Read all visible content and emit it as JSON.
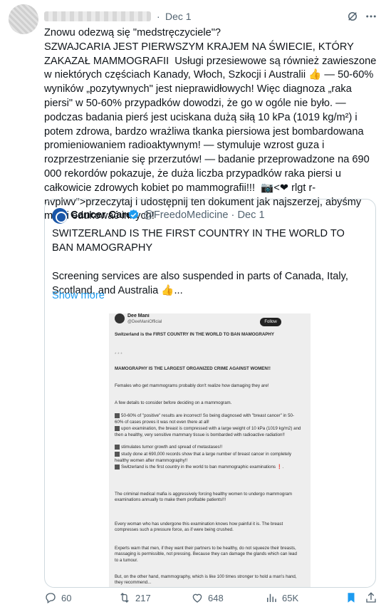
{
  "tweet": {
    "date": "Dec 1",
    "separator": "·",
    "text": "Znowu odezwą się \"medstręczyciele\"?\nSZWAJCARIA JEST PIERWSZYM KRAJEM NA ŚWIECIE, KTÓRY ZAKAZAŁ MAMMOGRAFII  Usługi przesiewowe są również zawieszone w niektórych częściach Kanady, Włoch, Szkocji i Australii 👍 — 50-60% wyników „pozytywnych\" jest nieprawidłowych! Więc diagnoza „raka piersi\" w 50-60% przypadków dowodzi, że go w ogóle nie było. — podczas badania pierś jest uciskana dużą siłą 10 kPa (1019 kg/m²) i potem zdrowa, bardzo wrażliwa tkanka piersiowa jest bombardowana promieniowaniem radioaktywnym! — stymuluje wzrost guza i rozprzestrzenianie się przerzutów! — badanie przeprowadzone na 690 000 rekordów pokazuje, że duża liczba przypadków raka piersi u całkowicie zdrowych kobiet po mammografii!!!  📷<❤ rlgt r-nvplwv\">przeczytaj i udostępnij ten dokument jak najszerzej, abyśmy mogli edukować innych!"
  },
  "quote": {
    "name": "Cancer Care",
    "handle": "@FreedoMedicine",
    "separator": "·",
    "date": "Dec 1",
    "text": "SWITZERLAND IS THE FIRST COUNTRY IN THE WORLD TO BAN MAMOGRAPHY\n\nScreening services are also suspended in parts of Canada, Italy, Scotland, and Australia 👍...",
    "show_more": "Show more"
  },
  "media": {
    "name": "Dee Mani",
    "handle": "@DeeManiOfficial",
    "follow": "Follow",
    "lines": [
      "Switzerland is the FIRST COUNTRY IN THE WORLD TO BAN MAMOGRAPHY",
      "* * *",
      "MAMOGRAPHY IS THE LARGEST ORGANIZED CRIME AGAINST WOMEN!!",
      "Females who get mammograms probably don't realize how damaging they are!",
      "A few details to consider before deciding on a mammogram.",
      "50-60% of \"positive\" results are incorrect! So being diagnosed with \"breast cancer\" in 50-60% of cases proves it was not even there at all!",
      "upon examination, the breast is compressed with a large weight of 10 kPa (1019 kg/m2) and then a healthy, very sensitive mammary tissue is bombarded with radioactive radiation!!",
      "stimulates tumor growth and spread of metastases!!",
      "study done at 690,000 records show that a large number of breast cancer in completely healthy women after mammography!!",
      "Switzerland is the first country in the world to ban mammographic examinations ❗.",
      "The criminal medical mafia is aggressively forcing healthy women to undergo mammogram examinations annually to make them profitable patients!!!",
      "Every woman who has undergone this examination knows how painful it is. The breast compresses such a pressure force, as if were being crushed.",
      "Experts warn that men, if they want their partners to be healthy, do not squeeze their breasts, massaging is permissible, not pressing. Because they can damage the glands which can lead to a tumour.",
      "But, on the other hand, mammography, which is like 100 times stronger to hold a man's hand, they recommend..."
    ]
  },
  "actions": {
    "replies": "60",
    "retweets": "217",
    "likes": "648",
    "views": "65K"
  },
  "colors": {
    "accent": "#1d9bf0",
    "muted": "#536471",
    "border": "#cfd9de"
  }
}
